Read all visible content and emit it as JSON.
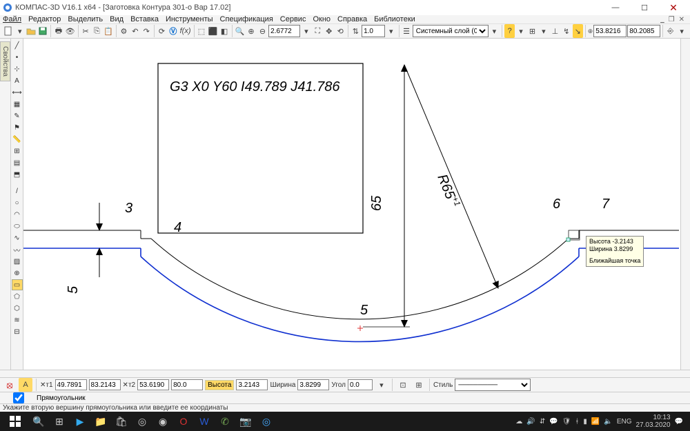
{
  "window": {
    "title": "КОМПАС-3D V16.1 x64 - [Заготовка Контура 301-о Вар 17.02]"
  },
  "menu": {
    "file": "Файл",
    "editor": "Редактор",
    "select": "Выделить",
    "view": "Вид",
    "insert": "Вставка",
    "tools": "Инструменты",
    "spec": "Спецификация",
    "service": "Сервис",
    "window": "Окно",
    "help": "Справка",
    "libs": "Библиотеки"
  },
  "toolbar1": {
    "zoom_value": "2.6772",
    "scale_value": "1.0",
    "layer_combo": "Системный слой (0)",
    "coord_x": "53.8216",
    "coord_y": "80.2085"
  },
  "sidebar_tab": "Свойства",
  "drawing": {
    "gcode": "G3 X0 Y60 I49.789 J41.786",
    "label3": "3",
    "label4": "4",
    "label5_left": "5",
    "label5_bottom": "5",
    "label6": "6",
    "label7": "7",
    "dim65": "65",
    "dimR": "R65",
    "dimR_sup": "+1"
  },
  "tooltip": {
    "line1": "Высота -3.2143",
    "line2": "Ширина 3.8299",
    "line3": "Ближайшая точка"
  },
  "props": {
    "t1_lbl": "т1",
    "t1_x": "49.7891",
    "t1_y": "83.2143",
    "t2_lbl": "т2",
    "t2_x": "53.6190",
    "t2_y": "80.0",
    "height_lbl": "Высота",
    "height_val": "3.2143",
    "width_lbl": "Ширина",
    "width_val": "3.8299",
    "angle_lbl": "Угол",
    "angle_val": "0.0",
    "style_lbl": "Стиль",
    "chk_label": "Прямоугольник"
  },
  "status": {
    "hint": "Укажите вторую вершину прямоугольника или введите ее координаты"
  },
  "tray": {
    "lang": "ENG",
    "time": "10:13",
    "date": "27.03.2020"
  }
}
